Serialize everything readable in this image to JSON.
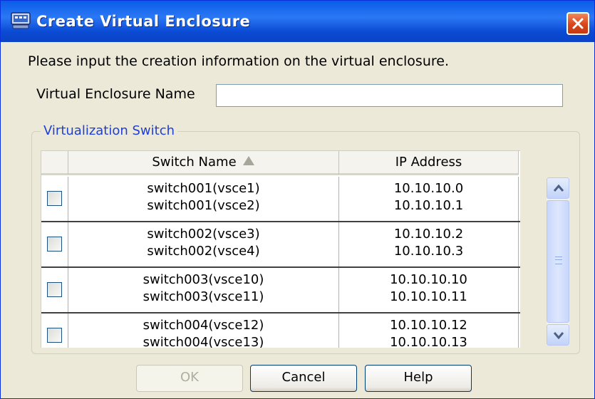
{
  "window": {
    "title": "Create Virtual Enclosure"
  },
  "instruction": "Please input the creation information on the virtual enclosure.",
  "form": {
    "name_label": "Virtual Enclosure Name",
    "name_value": ""
  },
  "group": {
    "title": "Virtualization Switch"
  },
  "table": {
    "columns": [
      "",
      "Switch Name",
      "IP Address"
    ],
    "sort": "ascending",
    "rows": [
      {
        "checked": false,
        "names": [
          "switch001(vsce1)",
          "switch001(vsce2)"
        ],
        "ips": [
          "10.10.10.0",
          "10.10.10.1"
        ]
      },
      {
        "checked": false,
        "names": [
          "switch002(vsce3)",
          "switch002(vsce4)"
        ],
        "ips": [
          "10.10.10.2",
          "10.10.10.3"
        ]
      },
      {
        "checked": false,
        "names": [
          "switch003(vsce10)",
          "switch003(vsce11)"
        ],
        "ips": [
          "10.10.10.10",
          "10.10.10.11"
        ]
      },
      {
        "checked": false,
        "names": [
          "switch004(vsce12)",
          "switch004(vsce13)"
        ],
        "ips": [
          "10.10.10.12",
          "10.10.10.13"
        ]
      }
    ]
  },
  "buttons": {
    "ok": "OK",
    "cancel": "Cancel",
    "help": "Help"
  },
  "icons": {
    "title": "app-window-icon",
    "close": "close-icon",
    "sort": "sort-ascending-icon",
    "scroll_up": "chevron-up-icon",
    "scroll_down": "chevron-down-icon"
  },
  "colors": {
    "titlebar": "#0a5ce8",
    "close": "#d8451c",
    "group_title": "#2040d0",
    "window_bg": "#ece9d8"
  }
}
